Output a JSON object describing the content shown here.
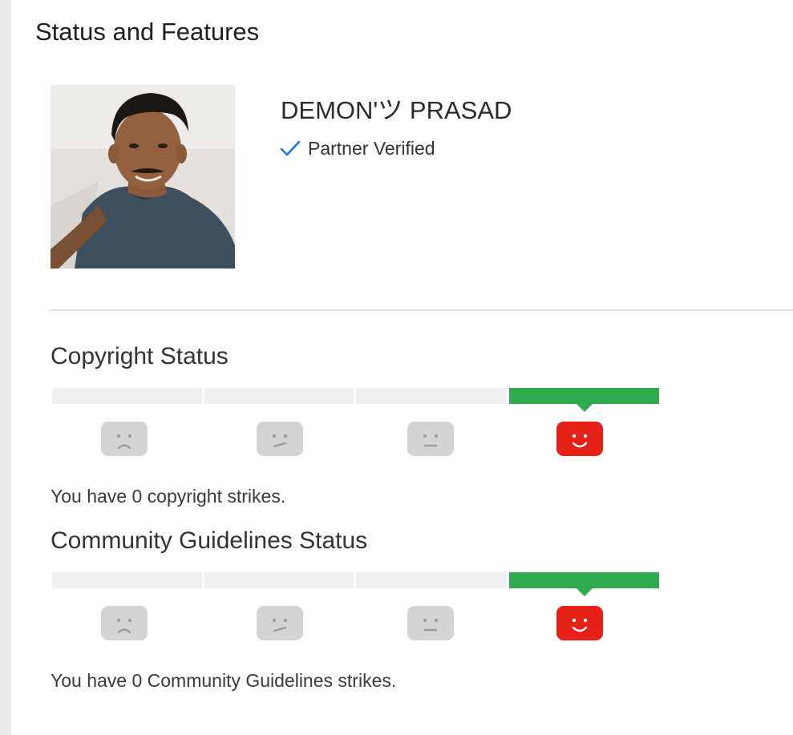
{
  "page": {
    "title": "Status and Features"
  },
  "channel": {
    "name": "DEMON'ツ PRASAD",
    "status_label": "Partner Verified"
  },
  "colors": {
    "accent_blue": "#1a73e8",
    "active_green": "#2faa4f",
    "inactive_gray": "#f0f0f0",
    "face_gray": "#d4d4d4",
    "face_red": "#e62117"
  },
  "copyright": {
    "title": "Copyright Status",
    "strikes": 0,
    "message": "You have 0 copyright strikes.",
    "levels": [
      {
        "icon": "sad-face-icon",
        "active": false
      },
      {
        "icon": "unsure-face-icon",
        "active": false
      },
      {
        "icon": "neutral-face-icon",
        "active": false
      },
      {
        "icon": "happy-face-icon",
        "active": true
      }
    ]
  },
  "community": {
    "title": "Community Guidelines Status",
    "strikes": 0,
    "message": "You have 0 Community Guidelines strikes.",
    "levels": [
      {
        "icon": "sad-face-icon",
        "active": false
      },
      {
        "icon": "unsure-face-icon",
        "active": false
      },
      {
        "icon": "neutral-face-icon",
        "active": false
      },
      {
        "icon": "happy-face-icon",
        "active": true
      }
    ]
  }
}
